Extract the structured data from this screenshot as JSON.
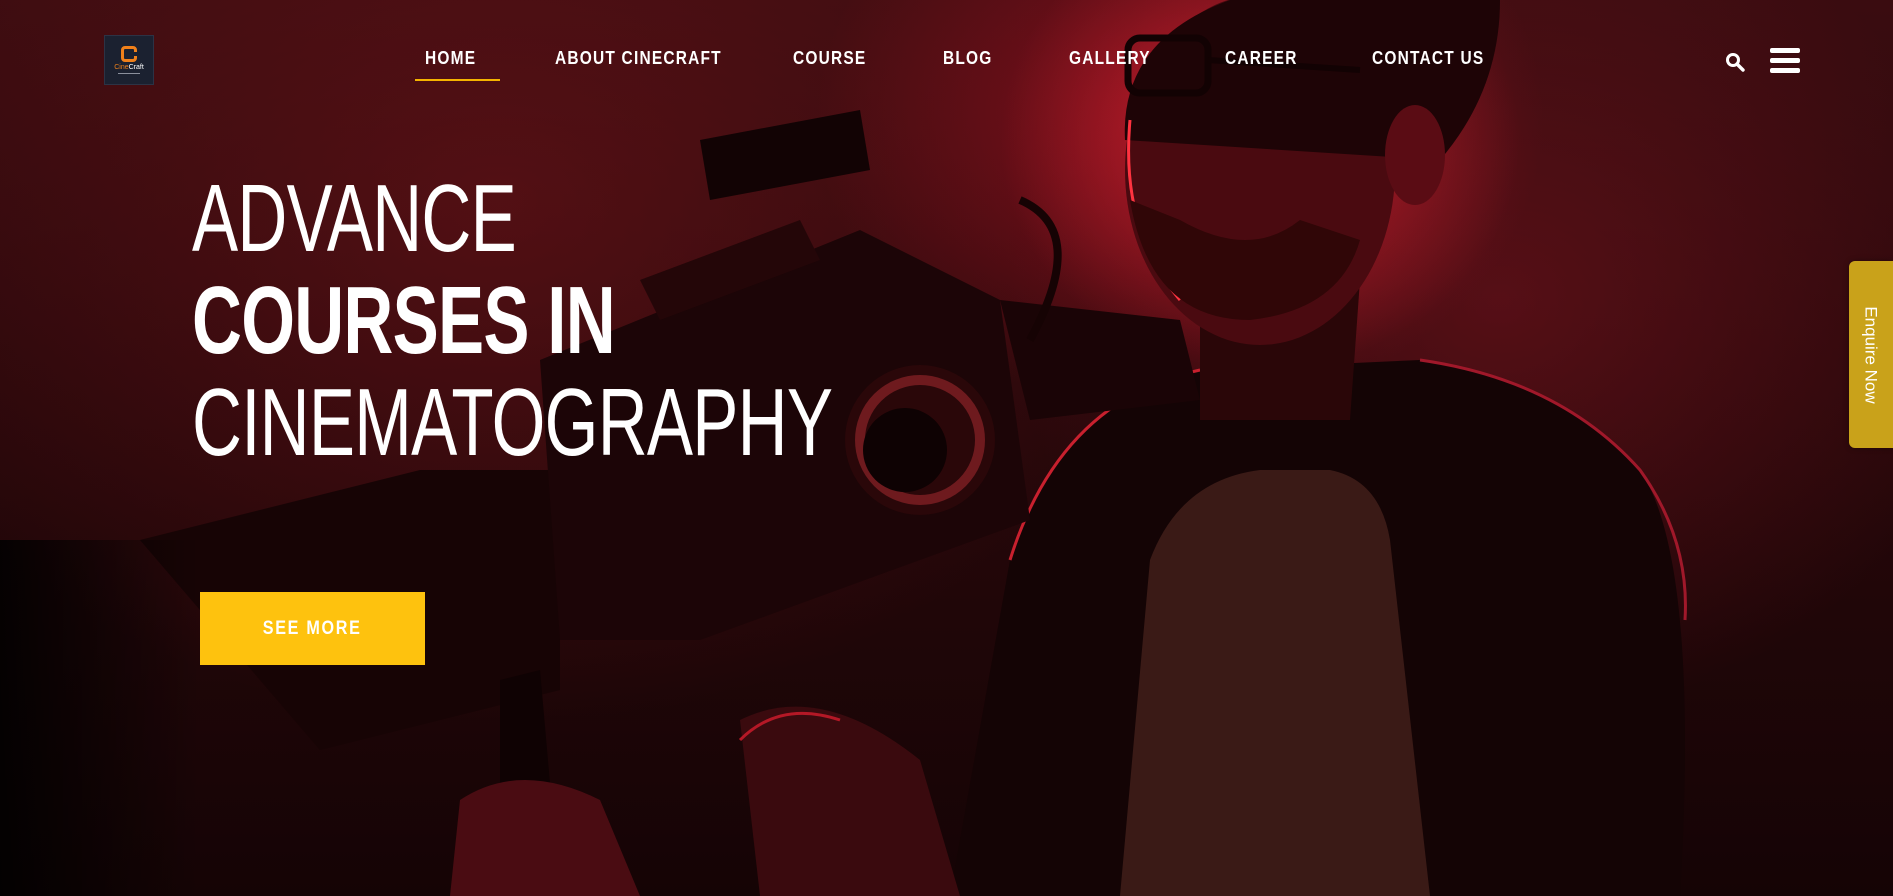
{
  "brand": {
    "logo_text_a": "Cine",
    "logo_text_b": "Craft",
    "accent": "#f6b400",
    "logo_color": "#f0801a"
  },
  "nav": {
    "items": [
      {
        "label": "HOME",
        "active": true
      },
      {
        "label": "ABOUT CINECRAFT",
        "active": false
      },
      {
        "label": "COURSE",
        "active": false
      },
      {
        "label": "BLOG",
        "active": false
      },
      {
        "label": "GALLERY",
        "active": false
      },
      {
        "label": "CAREER",
        "active": false
      },
      {
        "label": "CONTACT US",
        "active": false
      }
    ]
  },
  "header_icons": {
    "search": "search-icon",
    "menu": "hamburger-menu-icon"
  },
  "hero": {
    "line1": "ADVANCE",
    "line2": "COURSES IN",
    "line3": "CINEMATOGRAPHY",
    "cta_label": "SEE MORE",
    "cta_color": "#fec20e"
  },
  "side_tab": {
    "label": "Enquire Now",
    "color": "#c9a21a"
  }
}
